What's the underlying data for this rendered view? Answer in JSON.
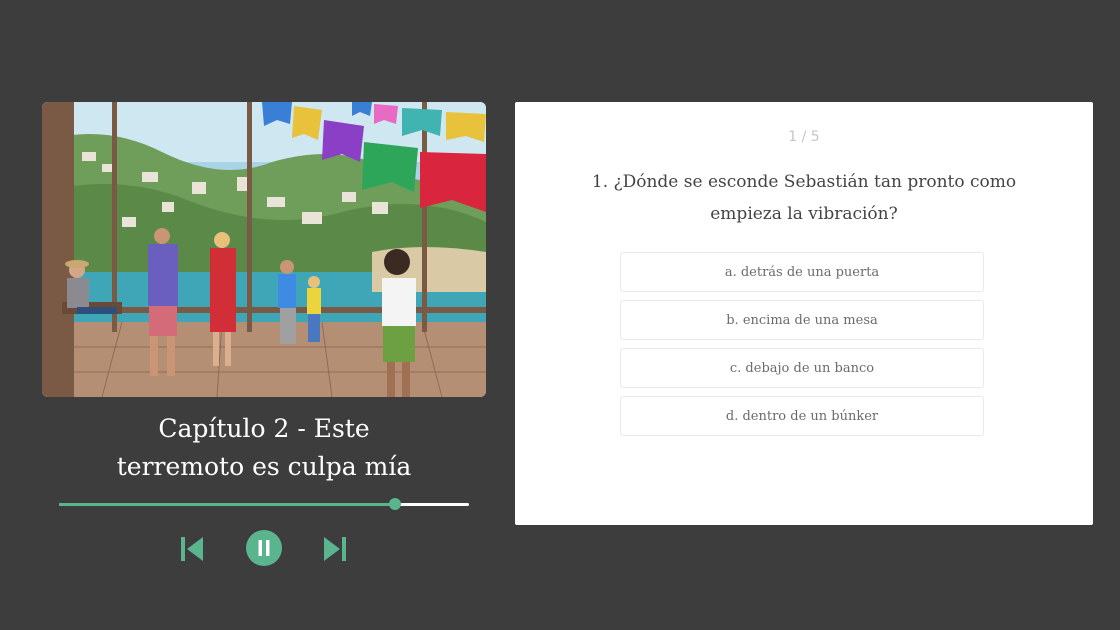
{
  "player": {
    "chapter_title_line1": "Capítulo 2 - Este",
    "chapter_title_line2": "terremoto es culpa mía",
    "progress": 0.82,
    "accent_color": "#5ab58e",
    "prev_icon": "skip-previous-icon",
    "pause_icon": "pause-icon",
    "next_icon": "skip-next-icon"
  },
  "quiz": {
    "counter": "1 / 5",
    "question_line1": "1. ¿Dónde se esconde Sebastián tan pronto como",
    "question_line2": "empieza la vibración?",
    "options": [
      "a. detrás de una puerta",
      "b. encima de una mesa",
      "c. debajo de un banco",
      "d. dentro de un búnker"
    ]
  }
}
